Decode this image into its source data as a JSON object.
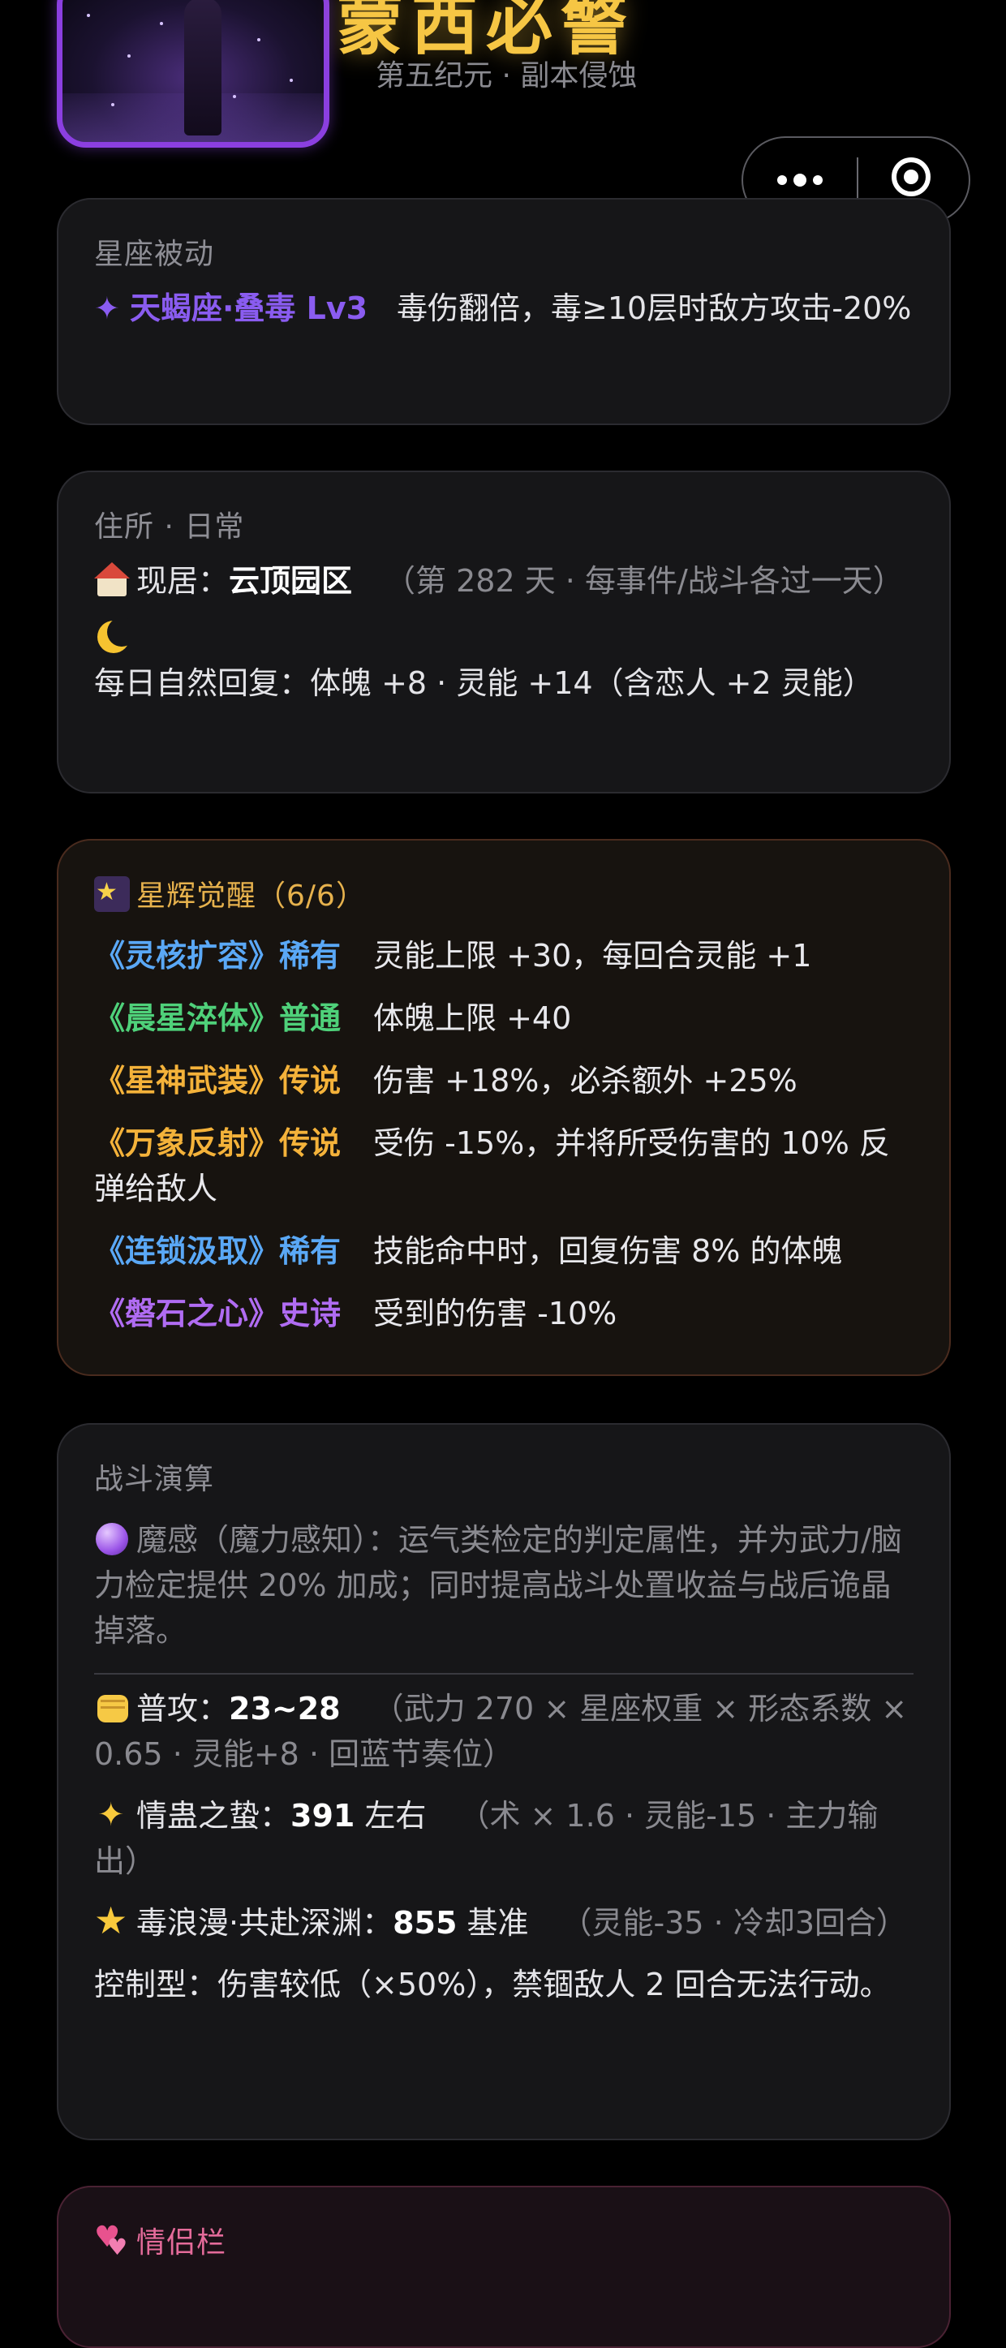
{
  "header": {
    "title": "蒙西必警",
    "subtitle": "第五纪元 · 副本侵蚀"
  },
  "capsule": {
    "more_icon": "more-dots-icon",
    "close_icon": "target-ring-icon"
  },
  "constellation": {
    "title": "星座被动",
    "skill_icon": "✦",
    "skill_name": "天蝎座·叠毒 Lv3",
    "skill_desc": "毒伤翻倍，毒≥10层时敌方攻击-20%"
  },
  "residence": {
    "title": "住所 · 日常",
    "current_label": "现居：",
    "current_value": "云顶园区",
    "current_note": "（第 282 天 · 每事件/战斗各过一天）",
    "recovery_text": "每日自然回复：体魄 +8 · 灵能 +14（含恋人 +2 灵能）"
  },
  "awakening": {
    "title": "星辉觉醒（6/6）",
    "items": [
      {
        "name": "《灵核扩容》稀有",
        "rarity": "rare",
        "desc": "灵能上限 +30，每回合灵能 +1"
      },
      {
        "name": "《晨星淬体》普通",
        "rarity": "common",
        "desc": "体魄上限 +40"
      },
      {
        "name": "《星神武装》传说",
        "rarity": "legend",
        "desc": "伤害 +18%，必杀额外 +25%"
      },
      {
        "name": "《万象反射》传说",
        "rarity": "legend",
        "desc": "受伤 -15%，并将所受伤害的 10% 反弹给敌人"
      },
      {
        "name": "《连锁汲取》稀有",
        "rarity": "rare",
        "desc": "技能命中时，回复伤害 8% 的体魄"
      },
      {
        "name": "《磐石之心》史诗",
        "rarity": "epic",
        "desc": "受到的伤害 -10%"
      }
    ]
  },
  "combat": {
    "title": "战斗演算",
    "sense_text": "魔感（魔力感知）：运气类检定的判定属性，并为武力/脑力检定提供 20% 加成；同时提高战斗处置收益与战后诡晶掉落。",
    "normal_label": "普攻：",
    "normal_value": "23~28",
    "normal_note": "（武力 270 × 星座权重 × 形态系数 × 0.65 · 灵能+8 · 回蓝节奏位）",
    "skill1_label": "情蛊之蛰：",
    "skill1_value": "391",
    "skill1_suffix": " 左右",
    "skill1_note": "（术 × 1.6 · 灵能-15 · 主力输出）",
    "skill2_label": "毒浪漫·共赴深渊：",
    "skill2_value": "855",
    "skill2_suffix": " 基准",
    "skill2_note": "（灵能-35 · 冷却3回合）",
    "control_text": "控制型：伤害较低（×50%），禁锢敌人 2 回合无法行动。"
  },
  "partner": {
    "title": "情侣栏"
  },
  "colors": {
    "rare": "#5aa8f6",
    "common": "#4fd17a",
    "legend": "#f4b23a",
    "epic": "#b06cf2",
    "title_gold": "#f6c644"
  }
}
